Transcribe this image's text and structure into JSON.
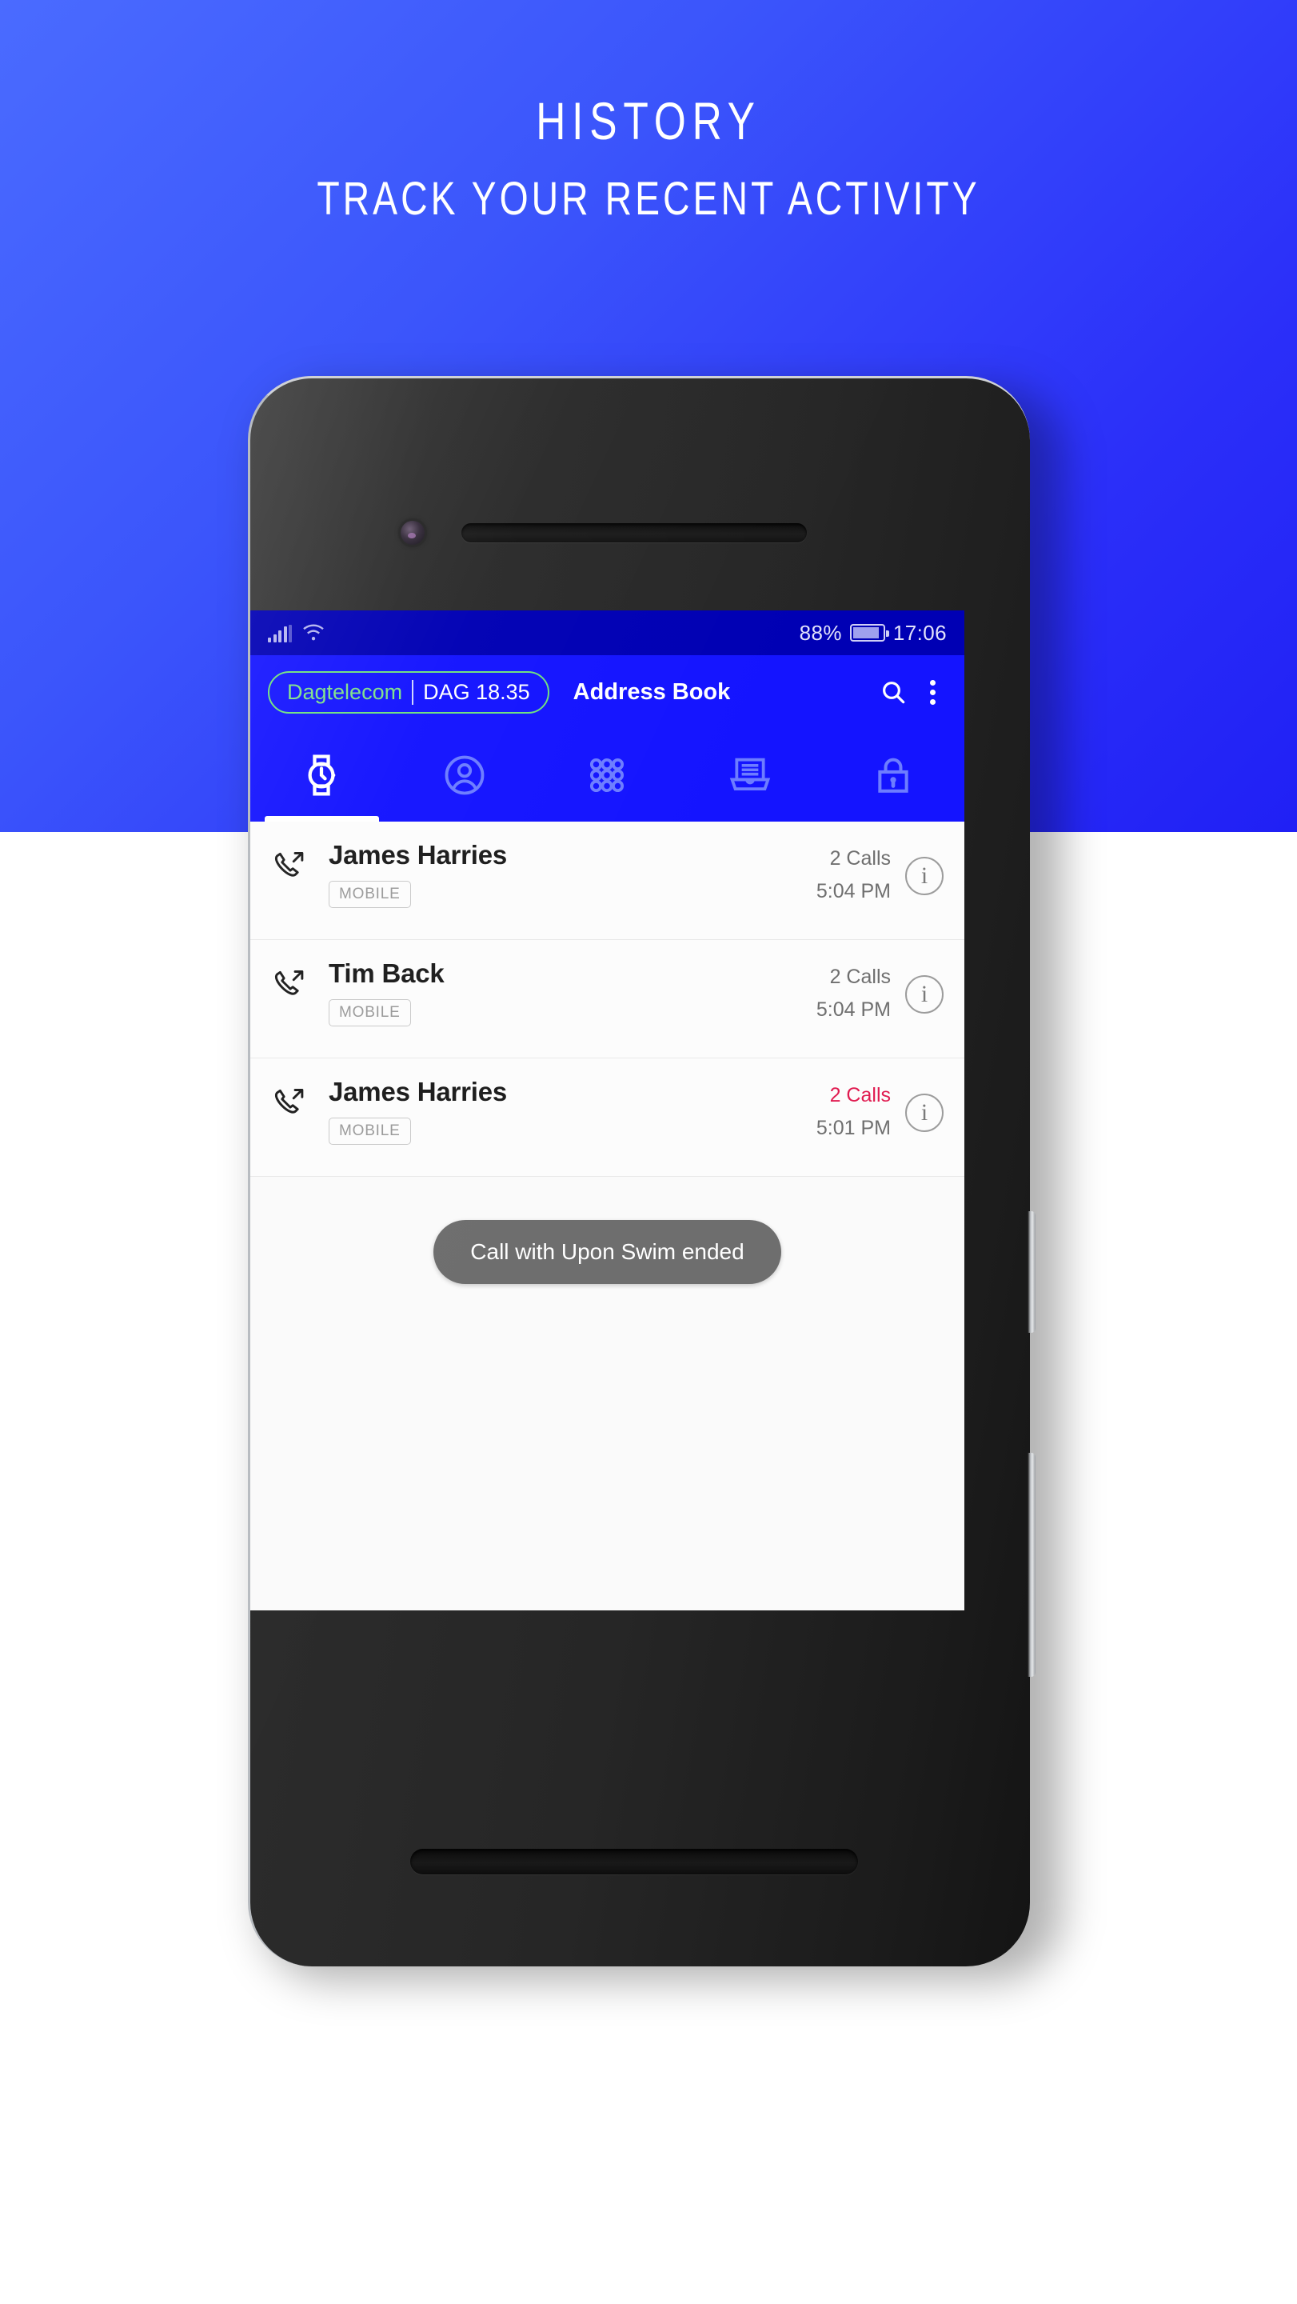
{
  "hero": {
    "title": "HISTORY",
    "subtitle": "TRACK YOUR RECENT ACTIVITY",
    "bg_top_color": "#2b2ff9",
    "bg_bottom_color": "#ffffff"
  },
  "status_bar": {
    "battery_percent": "88%",
    "time": "17:06",
    "signal_icon": "cellular-signal-icon",
    "wifi_icon": "wifi-icon",
    "battery_icon": "battery-icon"
  },
  "app_bar": {
    "brand_name": "Dagtelecom",
    "brand_version": "DAG 18.35",
    "brand_name_color": "#7ee08a",
    "title": "Address Book",
    "search_icon": "search-icon",
    "menu_icon": "overflow-menu-icon",
    "background_color": "#1414ff"
  },
  "tabs": [
    {
      "name": "history",
      "icon": "watch-history-icon",
      "active": true
    },
    {
      "name": "contacts",
      "icon": "person-circle-icon",
      "active": false
    },
    {
      "name": "keypad",
      "icon": "dialpad-icon",
      "active": false
    },
    {
      "name": "messages",
      "icon": "laptop-message-icon",
      "active": false
    },
    {
      "name": "secure",
      "icon": "lock-icon",
      "active": false
    }
  ],
  "call_history": {
    "rows": [
      {
        "direction_icon": "outgoing-call-icon",
        "name": "James Harries",
        "label": "MOBILE",
        "count": "2 Calls",
        "time": "5:04 PM",
        "missed": false,
        "info_icon": "info-icon"
      },
      {
        "direction_icon": "outgoing-call-icon",
        "name": "Tim Back",
        "label": "MOBILE",
        "count": "2 Calls",
        "time": "5:04 PM",
        "missed": false,
        "info_icon": "info-icon"
      },
      {
        "direction_icon": "outgoing-call-icon",
        "name": "James Harries",
        "label": "MOBILE",
        "count": "2 Calls",
        "time": "5:01 PM",
        "missed": true,
        "info_icon": "info-icon"
      }
    ],
    "missed_color": "#e01b50"
  },
  "toast": {
    "message": "Call with Upon Swim ended",
    "background_color": "#6e6e6e"
  }
}
